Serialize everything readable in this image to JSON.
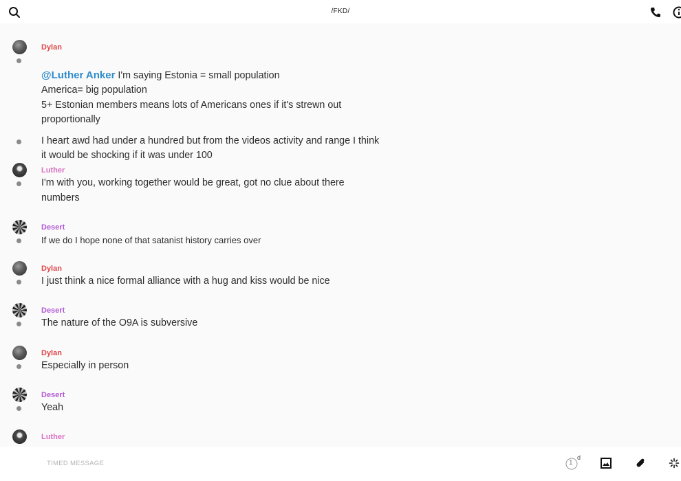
{
  "header": {
    "title": "/FKD/"
  },
  "icons": {
    "search": "search-icon",
    "phone": "phone-icon",
    "info": "info-icon",
    "timer": "timer-icon",
    "image": "image-icon",
    "attach": "paperclip-icon",
    "sparkle": "sparkle-icon"
  },
  "colors": {
    "dylan": "#e0454a",
    "luther": "#d86fc2",
    "desert": "#b35ad6",
    "mention": "#2e8ccc"
  },
  "messages": [
    {
      "author": "Dylan",
      "lines": [
        {
          "mention": "@Luther Anker",
          "text": " I'm saying Estonia = small population\nAmerica= big population\n5+ Estonian members means lots of Americans ones if it's strewn out proportionally"
        },
        {
          "text": "I heart awd had under a hundred but from the videos activity and range I think it would be shocking if it was under 100"
        }
      ]
    },
    {
      "author": "Luther",
      "lines": [
        {
          "text": "I'm with you, working together would be great, got no clue about there numbers"
        }
      ]
    },
    {
      "author": "Desert",
      "lines": [
        {
          "text": "If we do I hope none of that satanist history carries over"
        }
      ]
    },
    {
      "author": "Dylan",
      "lines": [
        {
          "text": "I just think a nice formal alliance with a hug and kiss would be nice"
        }
      ]
    },
    {
      "author": "Desert",
      "lines": [
        {
          "text": "The nature of the O9A is subversive"
        }
      ]
    },
    {
      "author": "Dylan",
      "lines": [
        {
          "text": "Especially in person"
        }
      ]
    },
    {
      "author": "Desert",
      "lines": [
        {
          "text": "Yeah"
        }
      ]
    },
    {
      "author": "Luther",
      "lines": []
    }
  ],
  "composer": {
    "placeholder": "TIMED MESSAGE",
    "timer_value": "1",
    "timer_unit": "d"
  }
}
